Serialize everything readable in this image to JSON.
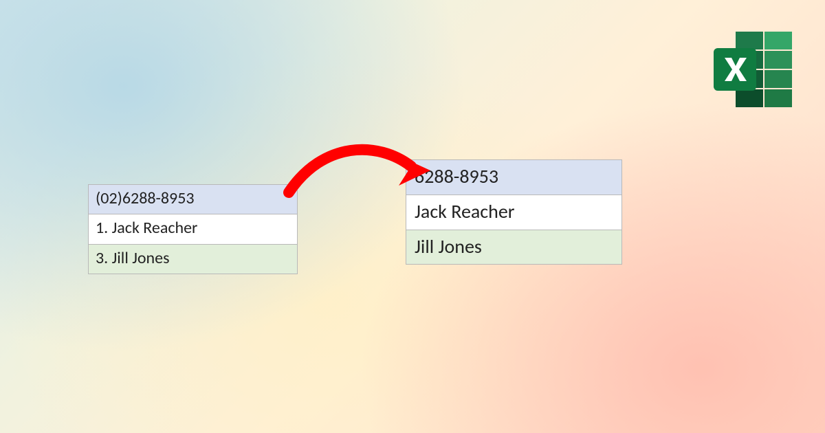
{
  "left_table": {
    "rows": [
      {
        "text": "(02)6288-8953",
        "style": "blue"
      },
      {
        "text": "1. Jack Reacher",
        "style": "white"
      },
      {
        "text": "3. Jill Jones",
        "style": "green"
      }
    ]
  },
  "right_table": {
    "rows": [
      {
        "text": "6288-8953",
        "style": "blue"
      },
      {
        "text": "Jack Reacher",
        "style": "white"
      },
      {
        "text": "Jill Jones",
        "style": "green"
      }
    ]
  },
  "icon": {
    "name": "excel-icon"
  },
  "arrow": {
    "color": "#ff0000"
  }
}
